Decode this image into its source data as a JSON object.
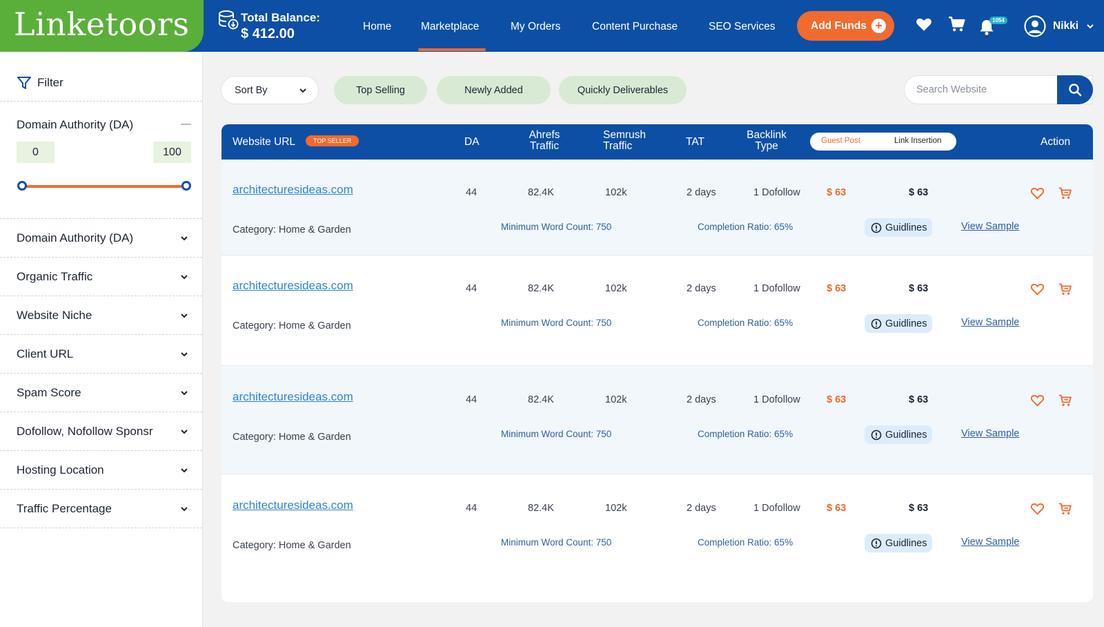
{
  "brand": {
    "logo_text": "Linketoors"
  },
  "header": {
    "balance_label": "Total Balance:",
    "balance_value": "$ 412.00",
    "nav": [
      "Home",
      "Marketplace",
      "My Orders",
      "Content Purchase",
      "SEO Services"
    ],
    "active_nav": "Marketplace",
    "add_funds_label": "Add Funds",
    "notification_count": "1054",
    "user_name": "Nikki"
  },
  "sidebar": {
    "filter_label": "Filter",
    "da_title": "Domain Authority (DA)",
    "da_min": "0",
    "da_max": "100",
    "filters": [
      "Domain Authority (DA)",
      "Organic Traffic",
      "Website Niche",
      "Client URL",
      "Spam Score",
      "Dofollow, Nofollow Sponsr",
      "Hosting Location",
      "Traffic Percentage"
    ]
  },
  "toolbar": {
    "sort_label": "Sort By",
    "chips": [
      "Top Selling",
      "Newly Added",
      "Quickly Deliverables"
    ],
    "search_placeholder": "Search Website"
  },
  "table": {
    "headers": {
      "website_url": "Website URL",
      "top_seller": "TOP SELLER",
      "da": "DA",
      "ahrefs_line1": "Ahrefs",
      "ahrefs_line2": "Traffic",
      "semrush_line1": "Semrush",
      "semrush_line2": "Traffic",
      "tat": "TAT",
      "backlink_line1": "Backlink",
      "backlink_line2": "Type",
      "toggle_guest": "Guest Post",
      "toggle_link": "Link Insertion",
      "action": "Action"
    },
    "rows": [
      {
        "url": "architecturesideas.com",
        "category": "Category: Home & Garden",
        "da": "44",
        "ahrefs": "82.4K",
        "semrush": "102k",
        "tat": "2 days",
        "backlink": "1 Dofollow",
        "guest_price": "$ 63",
        "link_price": "$ 63",
        "min_words": "Minimum Word Count: 750",
        "completion": "Completion Ratio: 65%",
        "guidelines": "Guidlines",
        "view_sample": "View Sample"
      },
      {
        "url": "architecturesideas.com",
        "category": "Category: Home & Garden",
        "da": "44",
        "ahrefs": "82.4K",
        "semrush": "102k",
        "tat": "2 days",
        "backlink": "1 Dofollow",
        "guest_price": "$ 63",
        "link_price": "$ 63",
        "min_words": "Minimum Word Count: 750",
        "completion": "Completion Ratio: 65%",
        "guidelines": "Guidlines",
        "view_sample": "View Sample"
      },
      {
        "url": "architecturesideas.com",
        "category": "Category: Home & Garden",
        "da": "44",
        "ahrefs": "82.4K",
        "semrush": "102k",
        "tat": "2 days",
        "backlink": "1 Dofollow",
        "guest_price": "$ 63",
        "link_price": "$ 63",
        "min_words": "Minimum Word Count: 750",
        "completion": "Completion Ratio: 65%",
        "guidelines": "Guidlines",
        "view_sample": "View Sample"
      },
      {
        "url": "architecturesideas.com",
        "category": "Category: Home & Garden",
        "da": "44",
        "ahrefs": "82.4K",
        "semrush": "102k",
        "tat": "2 days",
        "backlink": "1 Dofollow",
        "guest_price": "$ 63",
        "link_price": "$ 63",
        "min_words": "Minimum Word Count: 750",
        "completion": "Completion Ratio: 65%",
        "guidelines": "Guidlines",
        "view_sample": "View Sample"
      }
    ]
  },
  "colors": {
    "primary": "#0d4fa5",
    "brand_green": "#5aaf3a",
    "accent_orange": "#f26a2e",
    "chip_green": "#d8ead4",
    "link_blue": "#2a86d8"
  },
  "icons": [
    "database-download-icon",
    "heart-icon",
    "cart-icon",
    "bell-icon",
    "user-circle-icon",
    "chevron-down-icon",
    "filter-icon",
    "search-icon",
    "info-icon",
    "plus-icon"
  ]
}
